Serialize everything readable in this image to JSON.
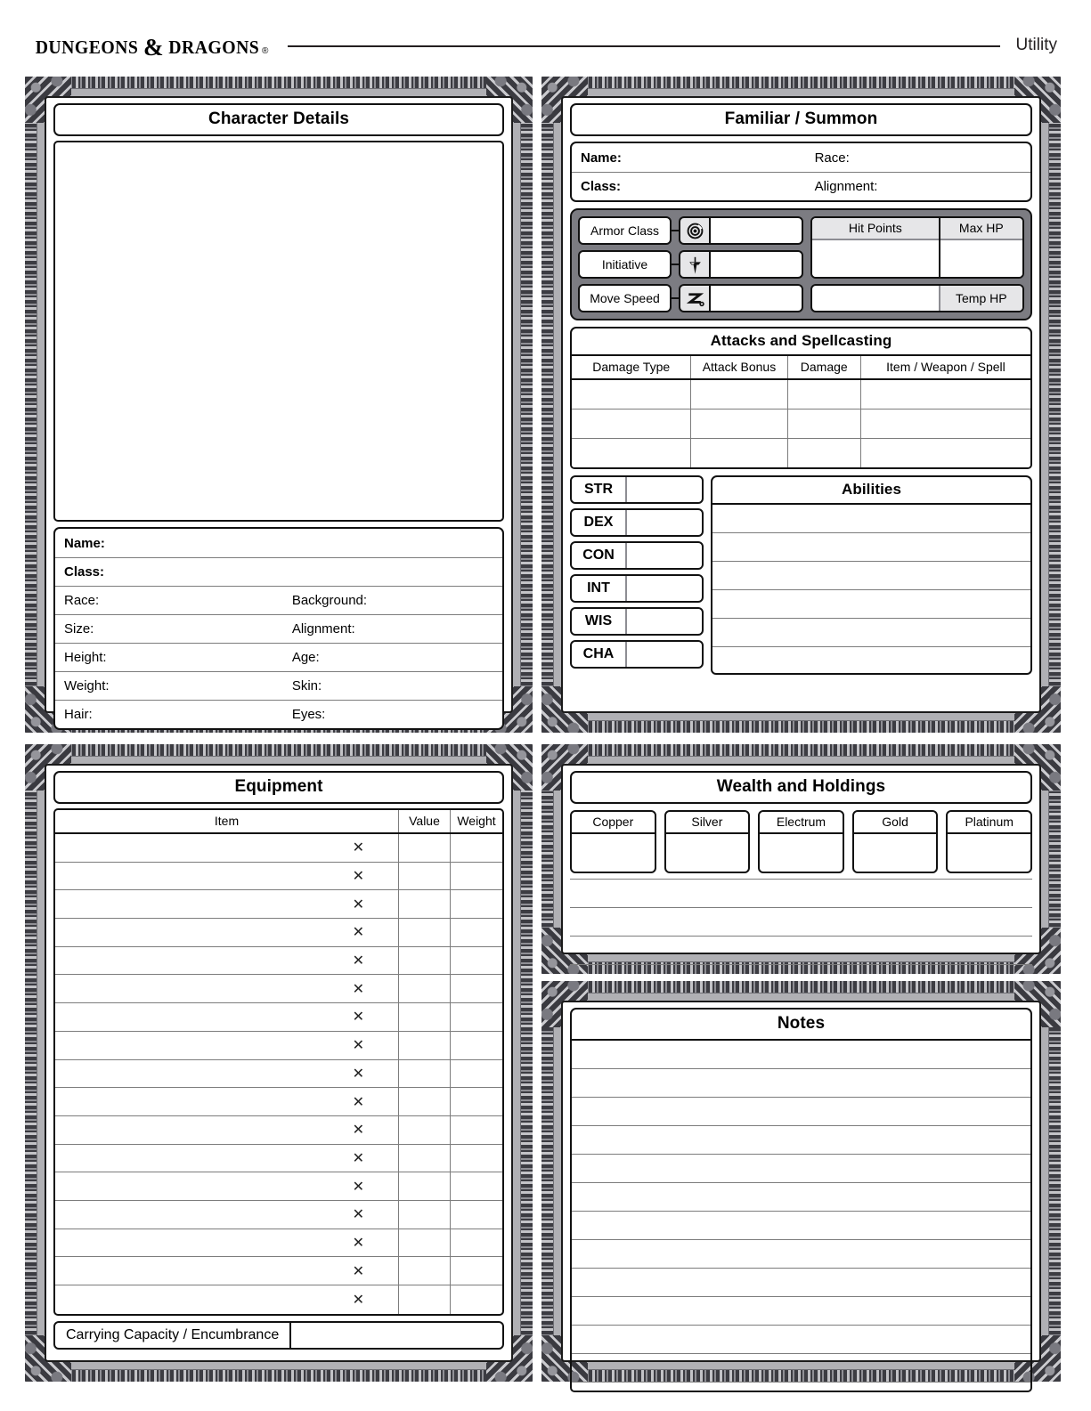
{
  "header": {
    "brand_main_1": "Dungeons",
    "brand_amp": "&",
    "brand_main_2": "Dragons",
    "brand_reg": "®",
    "title": "Utility"
  },
  "character_details": {
    "title": "Character Details",
    "fields": [
      {
        "label": "Name:",
        "bold": true,
        "label2": ""
      },
      {
        "label": "Class:",
        "bold": true,
        "label2": ""
      },
      {
        "label": "Race:",
        "bold": false,
        "label2": "Background:"
      },
      {
        "label": "Size:",
        "bold": false,
        "label2": "Alignment:"
      },
      {
        "label": "Height:",
        "bold": false,
        "label2": "Age:"
      },
      {
        "label": "Weight:",
        "bold": false,
        "label2": "Skin:"
      },
      {
        "label": "Hair:",
        "bold": false,
        "label2": "Eyes:"
      }
    ]
  },
  "familiar": {
    "title": "Familiar / Summon",
    "fields": [
      {
        "label": "Name:",
        "label2": "Race:"
      },
      {
        "label": "Class:",
        "label2": "Alignment:"
      }
    ],
    "stats": [
      {
        "label": "Armor Class",
        "icon": "armor-class-icon"
      },
      {
        "label": "Initiative",
        "icon": "initiative-dagger-icon"
      },
      {
        "label": "Move Speed",
        "icon": "move-speed-icon"
      }
    ],
    "hit_points_label": "Hit Points",
    "max_hp_label": "Max HP",
    "temp_hp_label": "Temp HP"
  },
  "attacks": {
    "title": "Attacks and Spellcasting",
    "columns": [
      "Damage Type",
      "Attack Bonus",
      "Damage",
      "Item / Weapon / Spell"
    ],
    "rows": [
      [
        "",
        "",
        "",
        ""
      ],
      [
        "",
        "",
        "",
        ""
      ],
      [
        "",
        "",
        "",
        ""
      ]
    ]
  },
  "ability_scores": {
    "items": [
      {
        "abbr": "STR",
        "value": ""
      },
      {
        "abbr": "DEX",
        "value": ""
      },
      {
        "abbr": "CON",
        "value": ""
      },
      {
        "abbr": "INT",
        "value": ""
      },
      {
        "abbr": "WIS",
        "value": ""
      },
      {
        "abbr": "CHA",
        "value": ""
      }
    ]
  },
  "abilities": {
    "title": "Abilities",
    "line_count": 6
  },
  "equipment": {
    "title": "Equipment",
    "columns": [
      "Item",
      "Value",
      "Weight"
    ],
    "multiplier_glyph": "✕",
    "row_count": 17,
    "rows": [
      {
        "item": "",
        "value": "",
        "weight": ""
      },
      {
        "item": "",
        "value": "",
        "weight": ""
      },
      {
        "item": "",
        "value": "",
        "weight": ""
      },
      {
        "item": "",
        "value": "",
        "weight": ""
      },
      {
        "item": "",
        "value": "",
        "weight": ""
      },
      {
        "item": "",
        "value": "",
        "weight": ""
      },
      {
        "item": "",
        "value": "",
        "weight": ""
      },
      {
        "item": "",
        "value": "",
        "weight": ""
      },
      {
        "item": "",
        "value": "",
        "weight": ""
      },
      {
        "item": "",
        "value": "",
        "weight": ""
      },
      {
        "item": "",
        "value": "",
        "weight": ""
      },
      {
        "item": "",
        "value": "",
        "weight": ""
      },
      {
        "item": "",
        "value": "",
        "weight": ""
      },
      {
        "item": "",
        "value": "",
        "weight": ""
      },
      {
        "item": "",
        "value": "",
        "weight": ""
      },
      {
        "item": "",
        "value": "",
        "weight": ""
      },
      {
        "item": "",
        "value": "",
        "weight": ""
      }
    ],
    "carrying_capacity_label": "Carrying Capacity / Encumbrance",
    "carrying_capacity_value": ""
  },
  "wealth": {
    "title": "Wealth and Holdings",
    "currencies": [
      {
        "label": "Copper",
        "value": ""
      },
      {
        "label": "Silver",
        "value": ""
      },
      {
        "label": "Electrum",
        "value": ""
      },
      {
        "label": "Gold",
        "value": ""
      },
      {
        "label": "Platinum",
        "value": ""
      }
    ],
    "line_count": 3
  },
  "notes": {
    "title": "Notes",
    "line_count": 11
  },
  "colors": {
    "ink": "#111111",
    "rule": "#7c7c7c",
    "frame_dark": "#3a3a40",
    "frame_gray": "#b0b0b4",
    "panel_shade": "#e6e6e8",
    "statblock_bg": "#7c7c82"
  }
}
